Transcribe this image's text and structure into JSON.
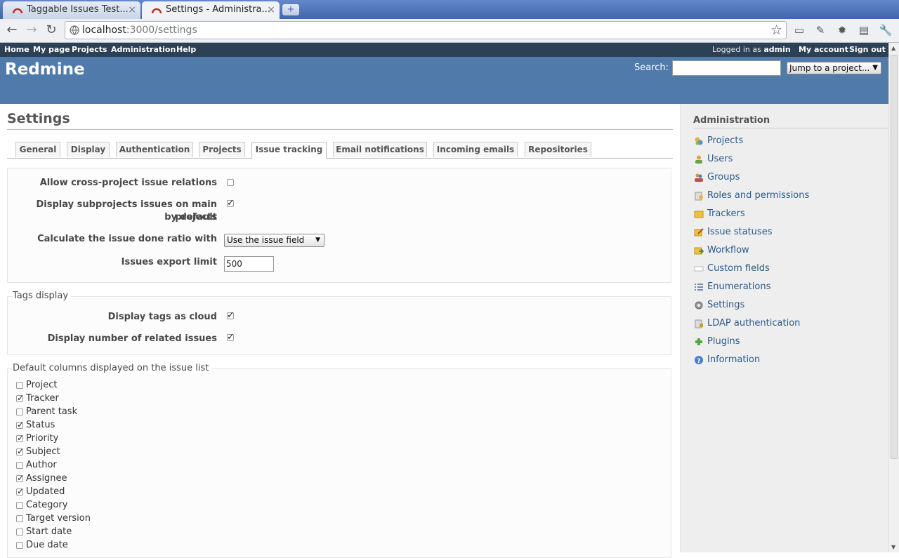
{
  "browser": {
    "tabs": [
      {
        "title": "Taggable Issues Test...",
        "active": false
      },
      {
        "title": "Settings - Administra...",
        "active": true
      }
    ],
    "url_host": "localhost",
    "url_rest": ":3000/settings",
    "new_tab_label": "+"
  },
  "top_menu": {
    "items": [
      "Home",
      "My page",
      "Projects",
      "Administration",
      "Help"
    ],
    "logged_in_prefix": "Logged in as",
    "user": "admin",
    "my_account": "My account",
    "sign_out": "Sign out"
  },
  "header": {
    "title": "Redmine",
    "search_label": "Search:",
    "jump_label": "Jump to a project..."
  },
  "page": {
    "title": "Settings",
    "tabs": [
      "General",
      "Display",
      "Authentication",
      "Projects",
      "Issue tracking",
      "Email notifications",
      "Incoming emails",
      "Repositories"
    ],
    "selected_tab": "Issue tracking"
  },
  "issue_tracking": {
    "cross_project_label": "Allow cross-project issue relations",
    "cross_project_checked": false,
    "subprojects_label_1": "Display subprojects issues on main projects",
    "subprojects_label_2": "by default",
    "subprojects_checked": true,
    "done_ratio_label": "Calculate the issue done ratio with",
    "done_ratio_value": "Use the issue field",
    "export_limit_label": "Issues export limit",
    "export_limit_value": "500"
  },
  "tags_display": {
    "legend": "Tags display",
    "cloud_label": "Display tags as cloud",
    "cloud_checked": true,
    "related_label": "Display number of related issues",
    "related_checked": true
  },
  "default_columns": {
    "legend": "Default columns displayed on the issue list",
    "items": [
      {
        "label": "Project",
        "checked": false
      },
      {
        "label": "Tracker",
        "checked": true
      },
      {
        "label": "Parent task",
        "checked": false
      },
      {
        "label": "Status",
        "checked": true
      },
      {
        "label": "Priority",
        "checked": true
      },
      {
        "label": "Subject",
        "checked": true
      },
      {
        "label": "Author",
        "checked": false
      },
      {
        "label": "Assignee",
        "checked": true
      },
      {
        "label": "Updated",
        "checked": true
      },
      {
        "label": "Category",
        "checked": false
      },
      {
        "label": "Target version",
        "checked": false
      },
      {
        "label": "Start date",
        "checked": false
      },
      {
        "label": "Due date",
        "checked": false
      }
    ]
  },
  "sidebar": {
    "title": "Administration",
    "items": [
      {
        "label": "Projects",
        "icon": "projects-icon"
      },
      {
        "label": "Users",
        "icon": "user-icon"
      },
      {
        "label": "Groups",
        "icon": "group-icon"
      },
      {
        "label": "Roles and permissions",
        "icon": "roles-icon"
      },
      {
        "label": "Trackers",
        "icon": "tracker-icon"
      },
      {
        "label": "Issue statuses",
        "icon": "issue-status-icon"
      },
      {
        "label": "Workflow",
        "icon": "workflow-icon"
      },
      {
        "label": "Custom fields",
        "icon": "custom-fields-icon"
      },
      {
        "label": "Enumerations",
        "icon": "list-icon"
      },
      {
        "label": "Settings",
        "icon": "gear-icon"
      },
      {
        "label": "LDAP authentication",
        "icon": "ldap-icon"
      },
      {
        "label": "Plugins",
        "icon": "plugin-icon"
      },
      {
        "label": "Information",
        "icon": "help-icon"
      }
    ]
  }
}
